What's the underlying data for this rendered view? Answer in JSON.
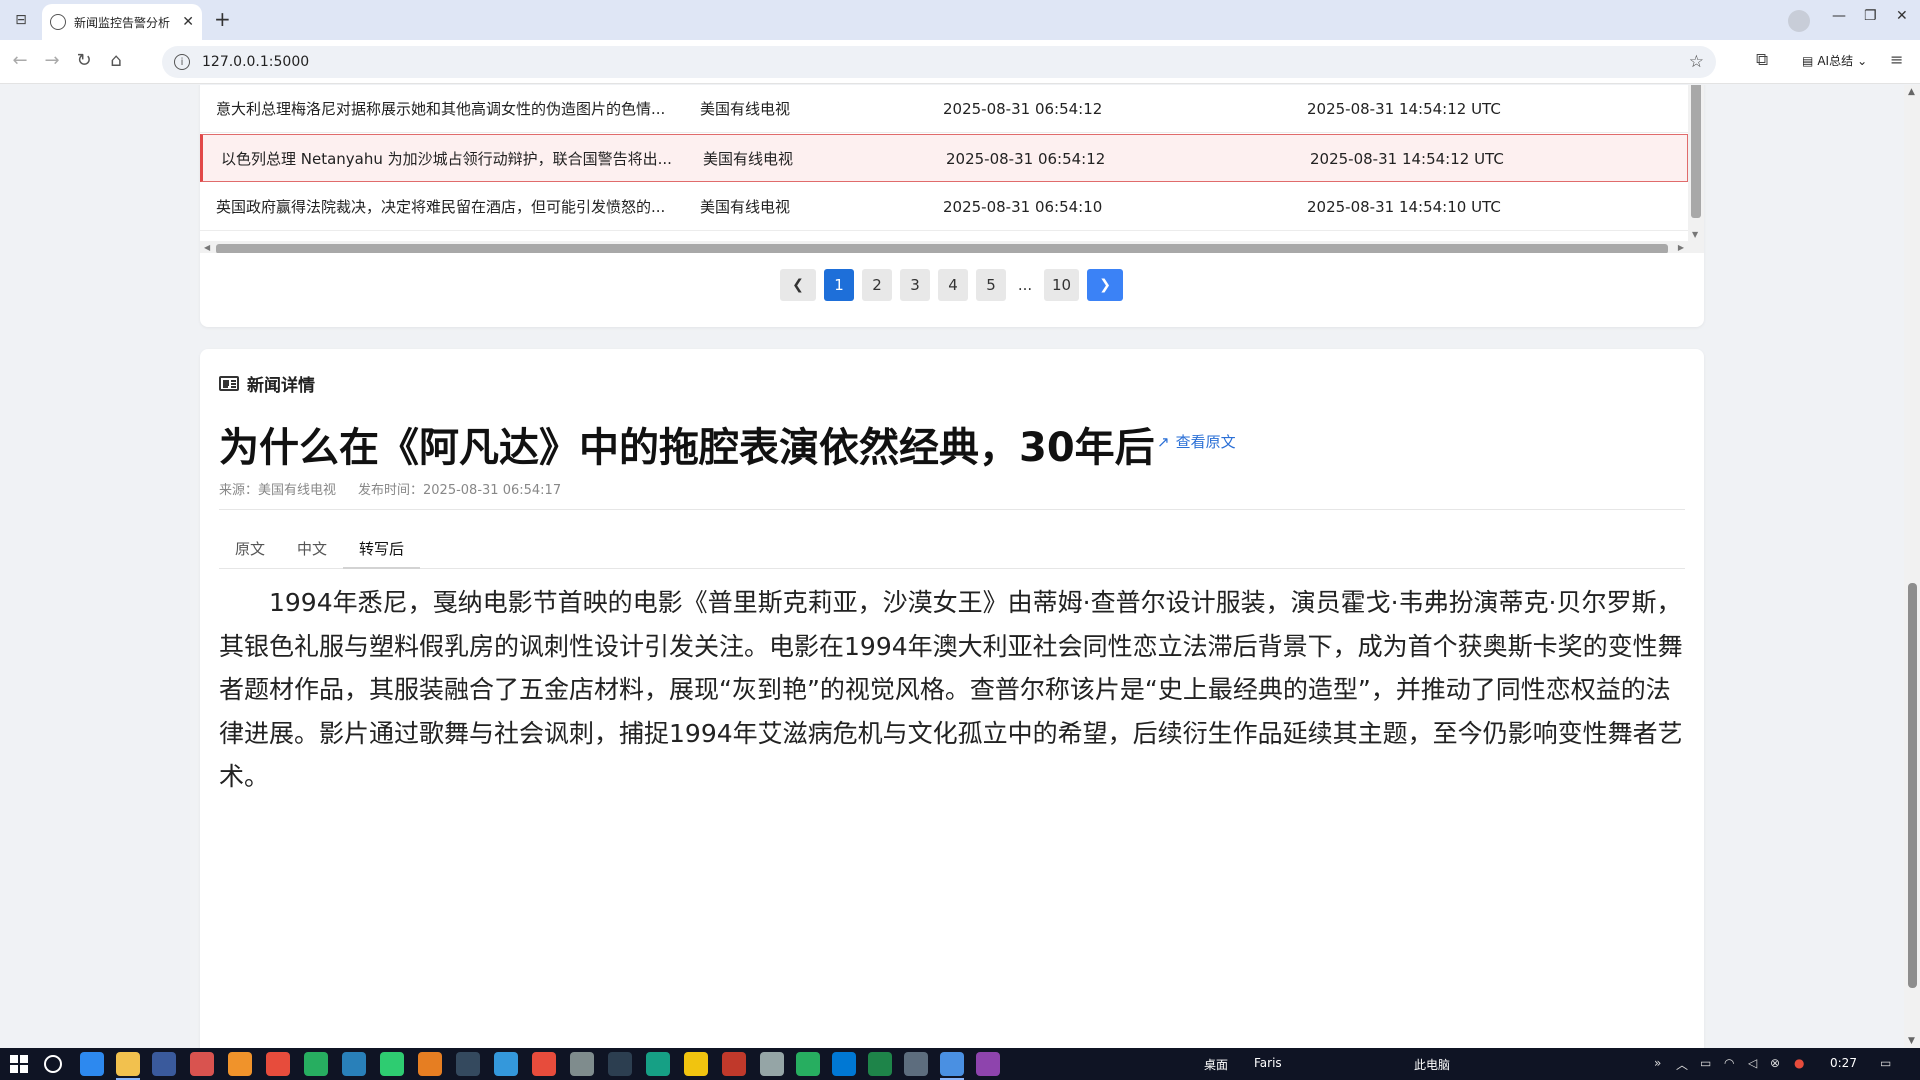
{
  "browser": {
    "tab_title": "新闻监控告警分析",
    "url": "127.0.0.1:5000",
    "ai_label": "AI总结"
  },
  "news_list": {
    "rows": [
      {
        "title": "意大利总理梅洛尼对据称展示她和其他高调女性的伪造图片的色情...",
        "source": "美国有线电视",
        "time": "2025-08-31 06:54:12",
        "utc": "2025-08-31 14:54:12 UTC",
        "alert": false
      },
      {
        "title": "以色列总理 Netanyahu 为加沙城占领行动辩护，联合国警告将出...",
        "source": "美国有线电视",
        "time": "2025-08-31 06:54:12",
        "utc": "2025-08-31 14:54:12 UTC",
        "alert": true
      },
      {
        "title": "英国政府赢得法院裁决，决定将难民留在酒店，但可能引发愤怒的...",
        "source": "美国有线电视",
        "time": "2025-08-31 06:54:10",
        "utc": "2025-08-31 14:54:10 UTC",
        "alert": false
      }
    ]
  },
  "pagination": {
    "pages": [
      "1",
      "2",
      "3",
      "4",
      "5"
    ],
    "ellipsis": "...",
    "last": "10",
    "current": "1"
  },
  "detail": {
    "header": "新闻详情",
    "title": "为什么在《阿凡达》中的拖腔表演依然经典，30年后",
    "original_link": "查看原文",
    "source": "来源：美国有线电视",
    "published": "发布时间：2025-08-31 06:54:17",
    "tabs": [
      "原文",
      "中文",
      "转写后"
    ],
    "active_tab": "转写后",
    "body": "1994年悉尼，戛纳电影节首映的电影《普里斯克莉亚，沙漠女王》由蒂姆·查普尔设计服装，演员霍戈·韦弗扮演蒂克·贝尔罗斯，其银色礼服与塑料假乳房的讽刺性设计引发关注。电影在1994年澳大利亚社会同性恋立法滞后背景下，成为首个获奥斯卡奖的变性舞者题材作品，其服装融合了五金店材料，展现“灰到艳”的视觉风格。查普尔称该片是“史上最经典的造型”，并推动了同性恋权益的法律进展。影片通过歌舞与社会讽刺，捕捉1994年艾滋病危机与文化孤立中的希望，后续衍生作品延续其主题，至今仍影响变性舞者艺术。"
  },
  "taskbar": {
    "desktop": "桌面",
    "user": "Faris",
    "computer": "此电脑",
    "clock": "0:27"
  },
  "colors": {
    "accent": "#1e6fd9",
    "alert_border": "#e14848",
    "alert_bg": "#fdf0f0",
    "link": "#2a6fd6"
  }
}
